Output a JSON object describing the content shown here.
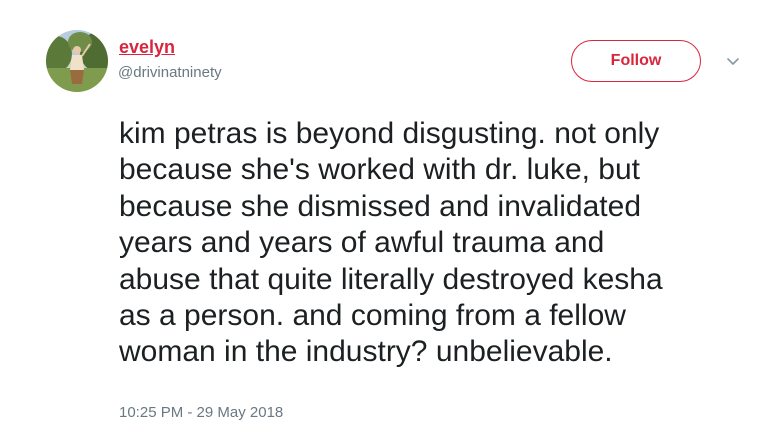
{
  "tweet": {
    "author": {
      "display_name": "evelyn",
      "handle": "@drivinatninety"
    },
    "follow_label": "Follow",
    "text_lines": [
      "kim petras is beyond disgusting. not only",
      "because she's worked with dr. luke, but",
      "because she dismissed and invalidated",
      "years and years of awful trauma and",
      "abuse that quite literally destroyed kesha",
      "as a person. and coming from a fellow",
      "woman in the industry? unbelievable."
    ],
    "timestamp": "10:25 PM - 29 May 2018",
    "icons": {
      "avatar": "avatar-photo",
      "menu": "chevron-down-icon"
    }
  },
  "colors": {
    "accent": "#d7263d",
    "text": "#1c2022",
    "secondary_text": "#697882"
  }
}
